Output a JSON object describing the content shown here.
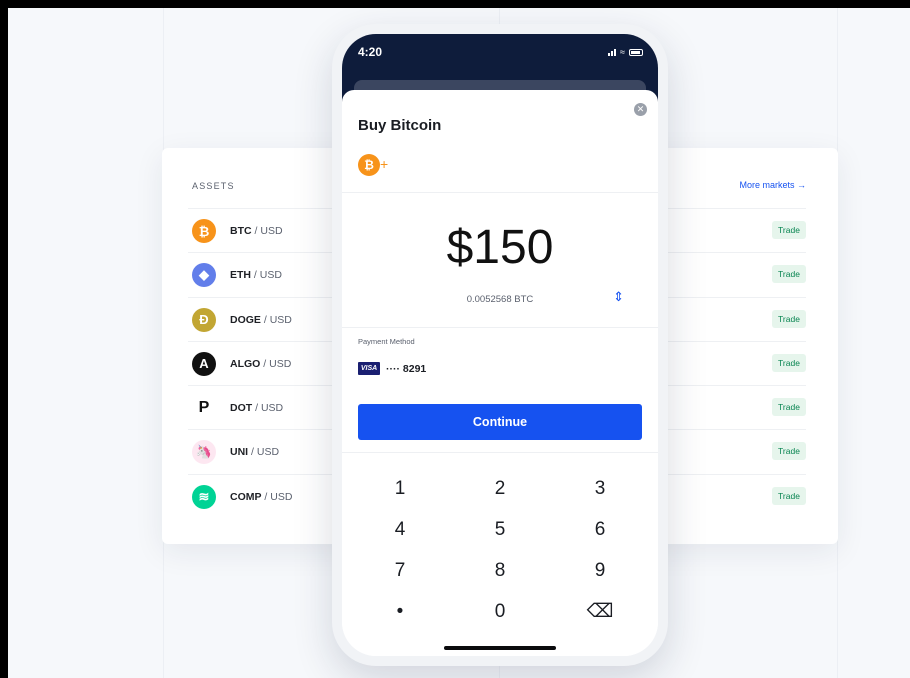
{
  "assets_table": {
    "heading": "ASSETS",
    "more_markets": "More markets →",
    "rows": [
      {
        "base": "BTC",
        "sep": " / ",
        "quote": "USD",
        "trade": "Trade",
        "icon": "bitcoin-icon",
        "glyph": "₿",
        "color": "#f7931a"
      },
      {
        "base": "ETH",
        "sep": " / ",
        "quote": "USD",
        "trade": "Trade",
        "icon": "ethereum-icon",
        "glyph": "◆",
        "color": "#627eea"
      },
      {
        "base": "DOGE",
        "sep": " / ",
        "quote": "USD",
        "trade": "Trade",
        "icon": "dogecoin-icon",
        "glyph": "Ð",
        "color": "#c2a633"
      },
      {
        "base": "ALGO",
        "sep": " / ",
        "quote": "USD",
        "trade": "Trade",
        "icon": "algorand-icon",
        "glyph": "A",
        "color": "#111111"
      },
      {
        "base": "DOT",
        "sep": " / ",
        "quote": "USD",
        "trade": "Trade",
        "icon": "polkadot-icon",
        "glyph": "P",
        "color": "#ffffff"
      },
      {
        "base": "UNI",
        "sep": " / ",
        "quote": "USD",
        "trade": "Trade",
        "icon": "uniswap-icon",
        "glyph": "🦄",
        "color": "#fde7f1"
      },
      {
        "base": "COMP",
        "sep": " / ",
        "quote": "USD",
        "trade": "Trade",
        "icon": "compound-icon",
        "glyph": "≋",
        "color": "#00d395"
      }
    ]
  },
  "phone": {
    "time": "4:20",
    "sheet_title": "Buy Bitcoin",
    "amount": "$150",
    "btc_amount": "0.0052568 BTC",
    "payment_label": "Payment Method",
    "card_brand": "VISA",
    "card_number": "···· 8291",
    "continue": "Continue",
    "keys": [
      "1",
      "2",
      "3",
      "4",
      "5",
      "6",
      "7",
      "8",
      "9",
      "•",
      "0",
      "⌫"
    ]
  },
  "colors": {
    "brand_blue": "#1652f0",
    "trade_green": "#098551",
    "status_bar": "#0e1c3b"
  }
}
